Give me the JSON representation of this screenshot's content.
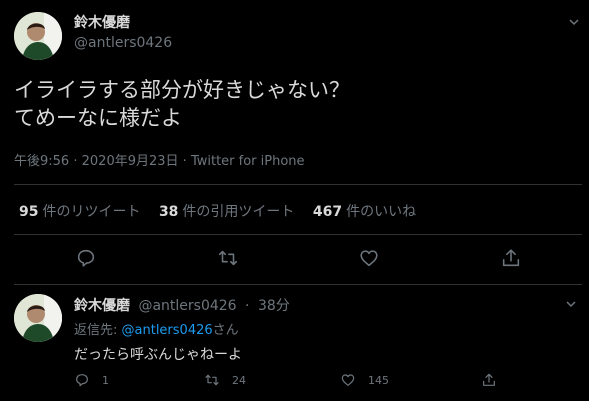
{
  "tweet": {
    "display_name": "鈴木優磨",
    "handle": "@antlers0426",
    "text_line1": "イライラする部分が好きじゃない？",
    "text_line2": "てめーなに様だよ",
    "time": "午後9:56",
    "date": "2020年9月23日",
    "source": "Twitter for iPhone",
    "separator": "·",
    "stats": {
      "retweets_count": "95",
      "retweets_label": "件のリツイート",
      "quotes_count": "38",
      "quotes_label": "件の引用ツイート",
      "likes_count": "467",
      "likes_label": "件のいいね"
    },
    "actions": [
      "reply-icon",
      "retweet-icon",
      "like-icon",
      "share-icon"
    ]
  },
  "reply": {
    "display_name": "鈴木優磨",
    "handle": "@antlers0426",
    "separator": "·",
    "age": "38分",
    "reply_to_prefix": "返信先: ",
    "reply_to_mention": "@antlers0426",
    "reply_to_suffix": "さん",
    "text": "だったら呼ぶんじゃねーよ",
    "reply_count": "1",
    "retweet_count": "24",
    "like_count": "145"
  },
  "colors": {
    "background": "#000000",
    "text": "#d9d9d9",
    "muted": "#6e767d",
    "divider": "#2f3336",
    "link": "#1d9bf0"
  }
}
